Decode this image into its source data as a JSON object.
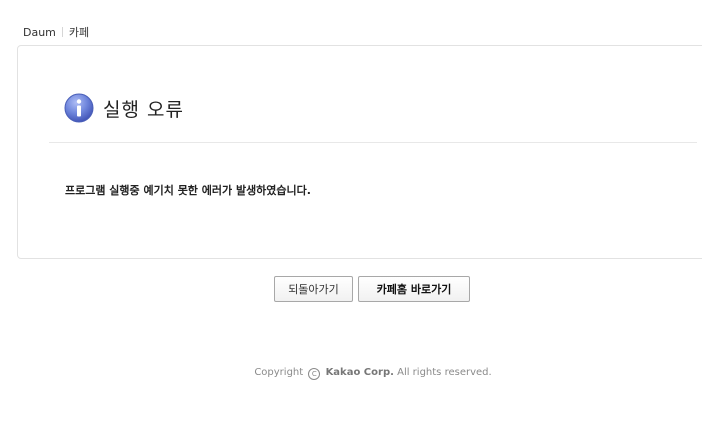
{
  "topnav": {
    "daum": "Daum",
    "cafe": "카페"
  },
  "error": {
    "title": "실행 오류",
    "icon": "info-icon",
    "message": "프로그램 실행중 예기치 못한 에러가 발생하였습니다."
  },
  "buttons": {
    "back": "되돌아가기",
    "cafe_home": "카페홈 바로가기"
  },
  "footer": {
    "copyright_prefix": "Copyright",
    "copyright_symbol": "C",
    "company": "Kakao Corp.",
    "rights": "All rights reserved."
  },
  "colors": {
    "icon_blue": "#5a73d0",
    "border": "#e2e2e2",
    "text": "#222222"
  }
}
